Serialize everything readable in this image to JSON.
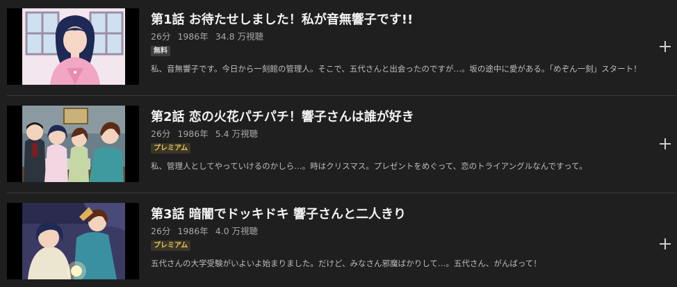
{
  "episodes": [
    {
      "title": "第1話 お待たせしました！私が音無響子です!!",
      "duration": "26分",
      "year": "1986年",
      "views": "34.8 万視聴",
      "badge": "無料",
      "badge_type": "free",
      "description": "私、音無響子です。今日から一刻館の管理人。そこで、五代さんと出会ったのですが…。坂の途中に愛がある。「めぞん一刻」スタート！",
      "add_icon": "plus-icon"
    },
    {
      "title": "第2話 恋の火花パチパチ！響子さんは誰が好き",
      "duration": "26分",
      "year": "1986年",
      "views": "5.4 万視聴",
      "badge": "プレミアム",
      "badge_type": "premium",
      "description": "私、管理人としてやっていけるのかしら…。時はクリスマス。プレゼントをめぐって、恋のトライアングルなんですって。",
      "add_icon": "plus-icon"
    },
    {
      "title": "第3話 暗闇でドッキドキ 響子さんと二人きり",
      "duration": "26分",
      "year": "1986年",
      "views": "4.0 万視聴",
      "badge": "プレミアム",
      "badge_type": "premium",
      "description": "五代さんの大学受験がいよいよ始まりました。だけど、みなさん邪魔ばかりして…。五代さん、がんばって！",
      "add_icon": "plus-icon"
    }
  ],
  "colors": {
    "background": "#1f1f1f",
    "premium_badge_text": "#e8c55a",
    "free_badge_bg": "#3d3d3d"
  }
}
